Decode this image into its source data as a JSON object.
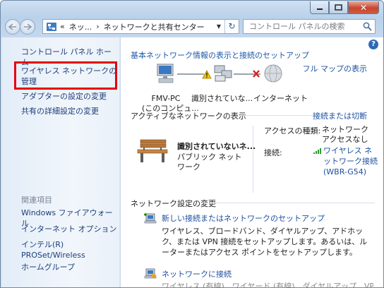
{
  "window": {
    "close_glyph": "✕"
  },
  "address": {
    "overflow": "«",
    "crumb1": "ネッ...",
    "separator": "›",
    "crumb2": "ネットワークと共有センター"
  },
  "search": {
    "placeholder": "コントロール パネルの検索"
  },
  "sidebar": {
    "home": "コントロール パネル ホーム",
    "wireless_manage": "ワイヤレス ネットワークの管理",
    "adapter": "アダプターの設定の変更",
    "advanced": "共有の詳細設定の変更",
    "related_heading": "関連項目",
    "firewall": "Windows ファイアウォール",
    "internet_options": "インターネット オプション",
    "proset": "インテル(R) PROSet/Wireless",
    "homegroup": "ホームグループ",
    "highlight_color": "#e6000f"
  },
  "main": {
    "heading": "基本ネットワーク情報の表示と接続のセットアップ",
    "full_map": "フル マップの表示",
    "map": {
      "pc_name": "FMV-PC",
      "pc_sub": "(このコンピュ...",
      "unidentified": "識別されていな...",
      "internet": "インターネット"
    },
    "active_title": "アクティブなネットワークの表示",
    "connect_disconnect": "接続または切断",
    "network": {
      "name": "識別されていないネ...",
      "type": "パブリック ネットワーク",
      "access_label": "アクセスの種類:",
      "access_value": "ネットワーク アクセスなし",
      "connections_label": "接続:",
      "connection_link": "ワイヤレス ネットワーク接続 (WBR-G54)"
    },
    "settings_title": "ネットワーク設定の変更",
    "task1": {
      "title": "新しい接続またはネットワークのセットアップ",
      "desc": "ワイヤレス、ブロードバンド、ダイヤルアップ、アドホック、または VPN 接続をセットアップします。あるいは、ルーターまたはアクセス ポイントをセットアップします。"
    },
    "task2": {
      "title": "ネットワークに接続",
      "desc": "ワイヤレス (有線)、ワイヤード (有線)、ダイヤルアップ、VPN"
    }
  },
  "colors": {
    "link": "#1e50a0",
    "sidebar_link": "#1e3e7a",
    "accent": "#2e69b5"
  }
}
